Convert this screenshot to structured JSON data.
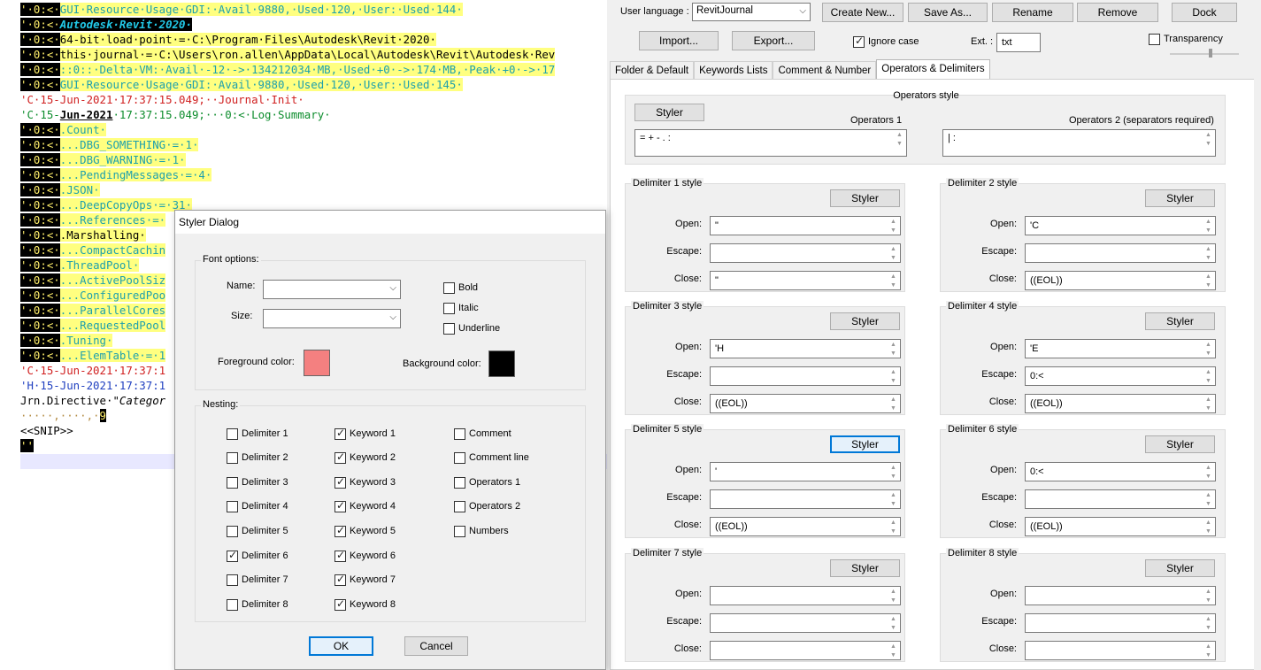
{
  "editor": {
    "lines": [
      [
        {
          "c": "t-kw",
          "t": "'·0:<·"
        },
        {
          "c": "t-hl",
          "t": "GUI·Resource·Usage·GDI:·Avail·9880,·Used·120,·User:·Used·144·"
        }
      ],
      [
        {
          "c": "t-kw",
          "t": "'·0:<·"
        },
        {
          "c": "t-cyan",
          "t": "Autodesk·Revit·2020·"
        }
      ],
      [
        {
          "c": "t-kw",
          "t": "'·0:<·"
        },
        {
          "c": "t-hl2",
          "t": "64-bit·load·point·=·C:\\Program·Files\\Autodesk\\Revit·2020·"
        }
      ],
      [
        {
          "c": "t-kw",
          "t": "'·0:<·"
        },
        {
          "c": "t-hl2",
          "t": "this·journal·=·C:\\Users\\ron.allen\\AppData\\Local\\Autodesk\\Revit\\Autodesk·Rev"
        }
      ],
      [
        {
          "c": "t-kw",
          "t": "'·0:<·"
        },
        {
          "c": "t-hl",
          "t": "::0::·Delta·VM:·Avail·-12·->·134212034·MB,·Used·+0·->·174·MB,·Peak·+0·->·17"
        }
      ],
      [
        {
          "c": "t-kw",
          "t": "'·0:<·"
        },
        {
          "c": "t-hl",
          "t": "GUI·Resource·Usage·GDI:·Avail·9880,·Used·120,·User:·Used·145·"
        }
      ],
      [
        {
          "c": "t-red",
          "t": "'C·15-Jun-2021·17:37:15.049;··Journal·Init·"
        }
      ],
      [
        {
          "c": "t-green",
          "t": "'C·15-"
        },
        {
          "c": "t-bold-u t-plain",
          "t": "Jun-2021"
        },
        {
          "c": "t-green",
          "t": "·17:37:15.049;···0:<·Log·Summary·"
        }
      ],
      [
        {
          "c": "t-kw",
          "t": "'·0:<·"
        },
        {
          "c": "t-hl",
          "t": ".Count·"
        }
      ],
      [
        {
          "c": "t-kw",
          "t": "'·0:<·"
        },
        {
          "c": "t-hl",
          "t": "...DBG_SOMETHING·=·1·"
        }
      ],
      [
        {
          "c": "t-kw",
          "t": "'·0:<·"
        },
        {
          "c": "t-hl",
          "t": "...DBG_WARNING·=·1·"
        }
      ],
      [
        {
          "c": "t-kw",
          "t": "'·0:<·"
        },
        {
          "c": "t-hl",
          "t": "...PendingMessages·=·4·"
        }
      ],
      [
        {
          "c": "t-kw",
          "t": "'·0:<·"
        },
        {
          "c": "t-hl",
          "t": ".JSON·"
        }
      ],
      [
        {
          "c": "t-kw",
          "t": "'·0:<·"
        },
        {
          "c": "t-hl",
          "t": "...DeepCopyOps·=·31·"
        }
      ],
      [
        {
          "c": "t-kw",
          "t": "'·0:<·"
        },
        {
          "c": "t-hl",
          "t": "...References·=·"
        }
      ],
      [
        {
          "c": "t-kw",
          "t": "'·0:<·"
        },
        {
          "c": "t-hl2",
          "t": ".Marshalling·"
        }
      ],
      [
        {
          "c": "t-kw",
          "t": "'·0:<·"
        },
        {
          "c": "t-hl",
          "t": "...CompactCachin"
        }
      ],
      [
        {
          "c": "t-kw",
          "t": "'·0:<·"
        },
        {
          "c": "t-hl",
          "t": ".ThreadPool·"
        }
      ],
      [
        {
          "c": "t-kw",
          "t": "'·0:<·"
        },
        {
          "c": "t-hl",
          "t": "...ActivePoolSiz"
        }
      ],
      [
        {
          "c": "t-kw",
          "t": "'·0:<·"
        },
        {
          "c": "t-hl",
          "t": "...ConfiguredPoo"
        }
      ],
      [
        {
          "c": "t-kw",
          "t": "'·0:<·"
        },
        {
          "c": "t-hl",
          "t": "...ParallelCores"
        }
      ],
      [
        {
          "c": "t-kw",
          "t": "'·0:<·"
        },
        {
          "c": "t-hl",
          "t": "...RequestedPool"
        }
      ],
      [
        {
          "c": "t-kw",
          "t": "'·0:<·"
        },
        {
          "c": "t-hl",
          "t": ".Tuning·"
        }
      ],
      [
        {
          "c": "t-kw",
          "t": "'·0:<·"
        },
        {
          "c": "t-hl",
          "t": "...ElemTable·=·1"
        }
      ],
      [
        {
          "c": "t-red",
          "t": "'C·15-Jun-2021·17:37:1"
        }
      ],
      [
        {
          "c": "t-blue",
          "t": "'H·15-Jun-2021·17:37:1"
        }
      ],
      [
        {
          "c": "t-plain",
          "t": "Jrn.Directive·"
        },
        {
          "c": "t-ital",
          "t": "\"Categor"
        }
      ],
      [
        {
          "c": "t-brown",
          "t": "·····,····,·"
        },
        {
          "c": "t-kw",
          "t": "9"
        }
      ],
      [
        {
          "c": "t-plain",
          "t": "<<SNIP>>"
        }
      ],
      [
        {
          "c": "t-kw",
          "t": "''"
        }
      ]
    ]
  },
  "dialog": {
    "title": "Styler Dialog",
    "font_options_label": "Font options:",
    "name_label": "Name:",
    "size_label": "Size:",
    "bold": "Bold",
    "italic": "Italic",
    "underline": "Underline",
    "fg_label": "Foreground color:",
    "bg_label": "Background color:",
    "fg_color": "#f48080",
    "bg_color": "#000000",
    "nesting_label": "Nesting:",
    "delimiters": [
      {
        "label": "Delimiter 1",
        "checked": false
      },
      {
        "label": "Delimiter 2",
        "checked": false
      },
      {
        "label": "Delimiter 3",
        "checked": false
      },
      {
        "label": "Delimiter 4",
        "checked": false
      },
      {
        "label": "Delimiter 5",
        "checked": false
      },
      {
        "label": "Delimiter 6",
        "checked": true
      },
      {
        "label": "Delimiter 7",
        "checked": false
      },
      {
        "label": "Delimiter 8",
        "checked": false
      }
    ],
    "keywords": [
      {
        "label": "Keyword 1",
        "checked": true
      },
      {
        "label": "Keyword 2",
        "checked": true
      },
      {
        "label": "Keyword 3",
        "checked": true
      },
      {
        "label": "Keyword 4",
        "checked": true
      },
      {
        "label": "Keyword 5",
        "checked": true
      },
      {
        "label": "Keyword 6",
        "checked": true
      },
      {
        "label": "Keyword 7",
        "checked": true
      },
      {
        "label": "Keyword 8",
        "checked": true
      }
    ],
    "others": [
      {
        "label": "Comment",
        "checked": false
      },
      {
        "label": "Comment line",
        "checked": false
      },
      {
        "label": "Operators 1",
        "checked": false
      },
      {
        "label": "Operators 2",
        "checked": false
      },
      {
        "label": "Numbers",
        "checked": false
      }
    ],
    "ok": "OK",
    "cancel": "Cancel"
  },
  "panel": {
    "user_language_label": "User language :",
    "user_language_value": "RevitJournal",
    "create_new": "Create New...",
    "save_as": "Save As...",
    "rename": "Rename",
    "remove": "Remove",
    "dock": "Dock",
    "import": "Import...",
    "export": "Export...",
    "ignore_case": "Ignore case",
    "ignore_case_checked": true,
    "ext_label": "Ext. :",
    "ext_value": "txt",
    "transparency": "Transparency",
    "transparency_checked": false,
    "tabs": [
      "Folder & Default",
      "Keywords Lists",
      "Comment & Number",
      "Operators & Delimiters"
    ],
    "active_tab": 3,
    "operators_style": "Operators style",
    "styler": "Styler",
    "operators1_label": "Operators 1",
    "operators2_label": "Operators 2 (separators required)",
    "operators1_value": "= + - . :",
    "operators2_value": "| :",
    "open_label": "Open:",
    "escape_label": "Escape:",
    "close_label": "Close:",
    "delimiters": [
      {
        "title": "Delimiter 1 style",
        "open": "\"",
        "escape": "",
        "close": "\""
      },
      {
        "title": "Delimiter 2 style",
        "open": "'C",
        "escape": "",
        "close": "((EOL))"
      },
      {
        "title": "Delimiter 3 style",
        "open": "'H",
        "escape": "",
        "close": "((EOL))"
      },
      {
        "title": "Delimiter 4 style",
        "open": "'E",
        "escape": "0:<",
        "close": "((EOL))"
      },
      {
        "title": "Delimiter 5 style",
        "open": "'",
        "escape": "",
        "close": "((EOL))"
      },
      {
        "title": "Delimiter 6 style",
        "open": "0:<",
        "escape": "",
        "close": "((EOL))"
      },
      {
        "title": "Delimiter 7 style",
        "open": "",
        "escape": "",
        "close": ""
      },
      {
        "title": "Delimiter 8 style",
        "open": "",
        "escape": "",
        "close": ""
      }
    ]
  }
}
